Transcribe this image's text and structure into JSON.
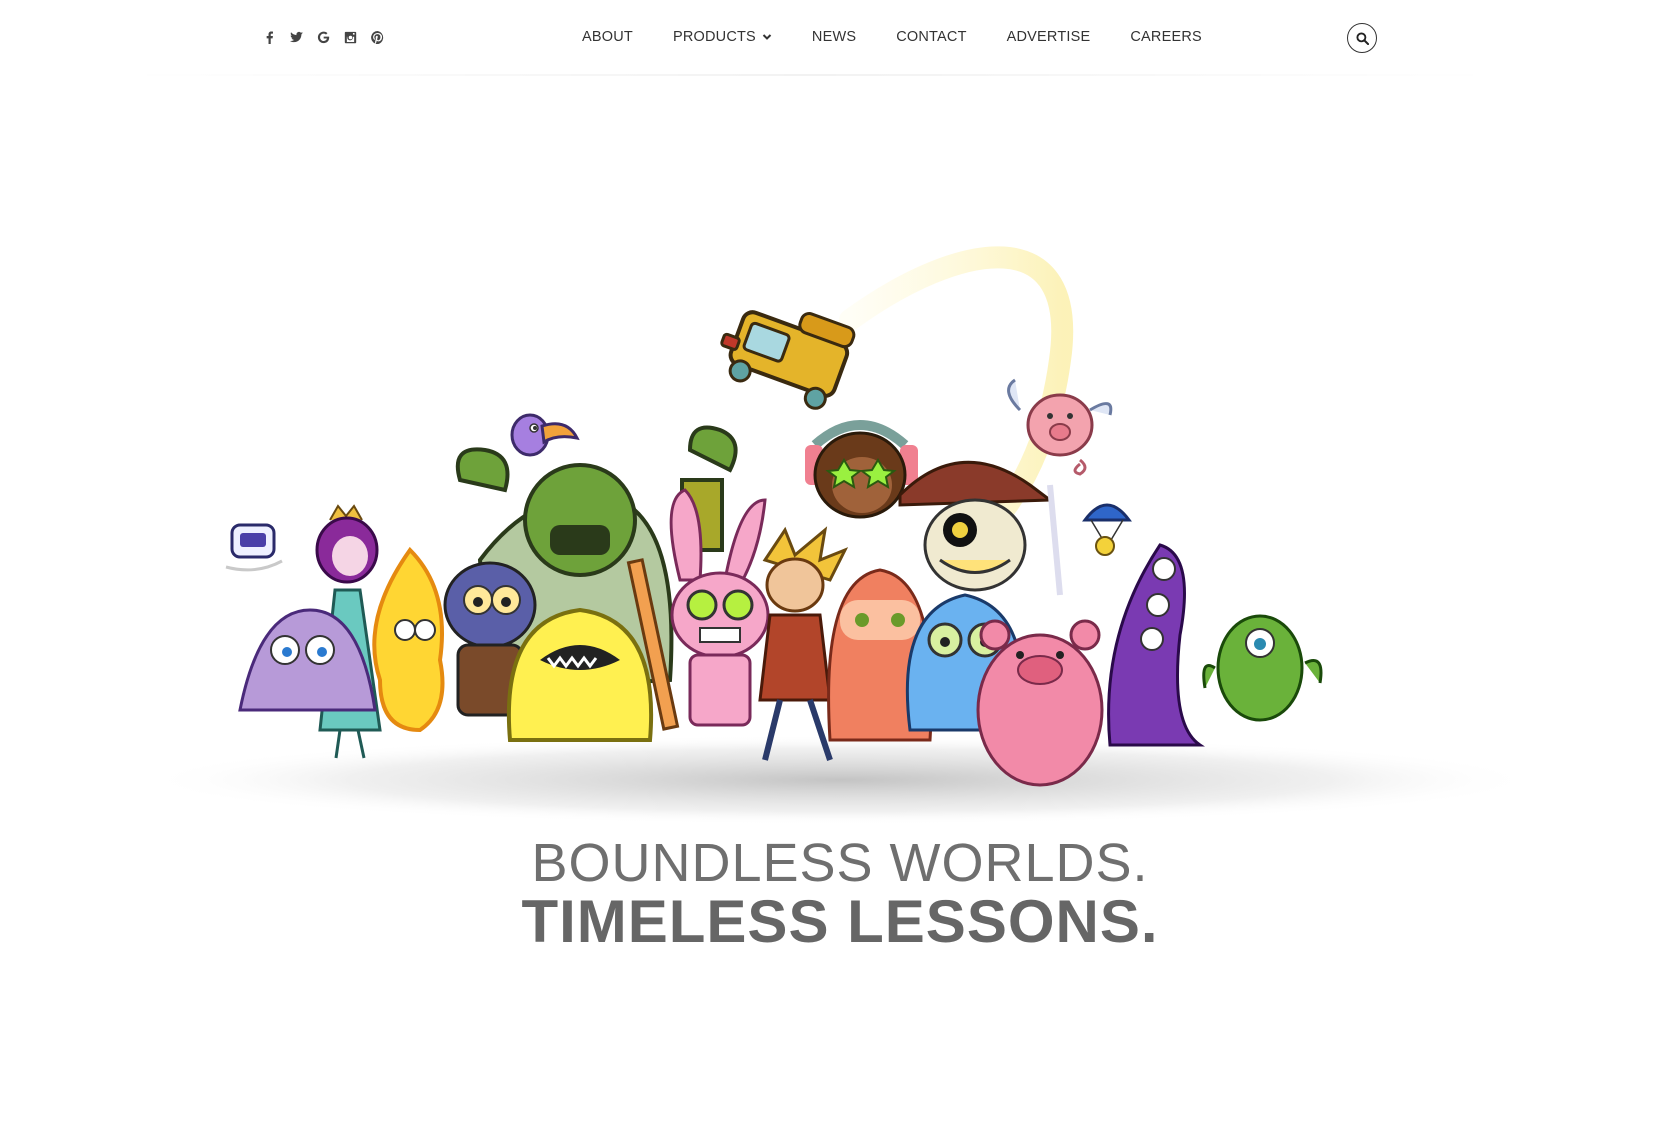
{
  "social": {
    "items": [
      {
        "name": "facebook-icon"
      },
      {
        "name": "twitter-icon"
      },
      {
        "name": "google-icon"
      },
      {
        "name": "instagram-icon"
      },
      {
        "name": "pinterest-icon"
      }
    ]
  },
  "nav": {
    "items": [
      {
        "label": "ABOUT"
      },
      {
        "label": "PRODUCTS",
        "has_dropdown": true
      },
      {
        "label": "NEWS"
      },
      {
        "label": "CONTACT"
      },
      {
        "label": "ADVERTISE"
      },
      {
        "label": "CAREERS"
      }
    ]
  },
  "search": {
    "icon": "search-icon"
  },
  "hero": {
    "illustration": "cartoon-characters-group"
  },
  "tagline": {
    "line1": "BOUNDLESS WORLDS.",
    "line2": "TIMELESS LESSONS."
  },
  "colors": {
    "text": "#333333",
    "tagline": "#6f6f6f"
  }
}
